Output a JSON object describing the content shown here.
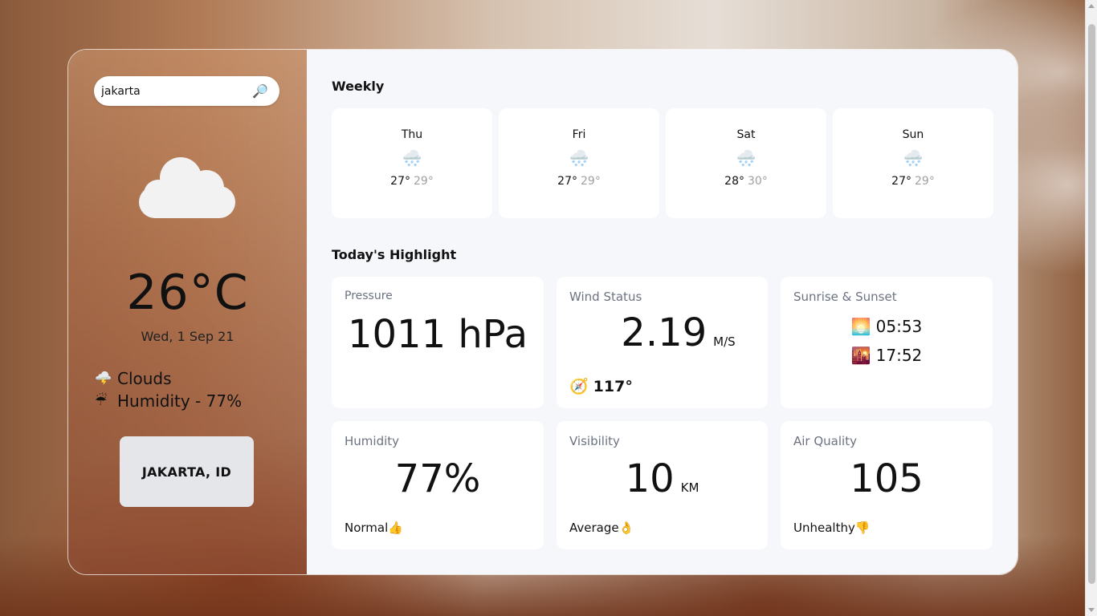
{
  "search": {
    "value": "jakarta",
    "icon": "magnifier-icon"
  },
  "current": {
    "icon": "cloud-icon",
    "temperature": "26°C",
    "date": "Wed, 1 Sep 21",
    "condition": "Clouds",
    "condition_icon": "🌩️",
    "humidity_text": "Humidity - 77%",
    "humidity_icon": "☔",
    "location": "JAKARTA, ID"
  },
  "weekly": {
    "title": "Weekly",
    "days": [
      {
        "name": "Thu",
        "icon": "🌨️",
        "low": "27°",
        "high": "29°"
      },
      {
        "name": "Fri",
        "icon": "🌨️",
        "low": "27°",
        "high": "29°"
      },
      {
        "name": "Sat",
        "icon": "🌨️",
        "low": "28°",
        "high": "30°"
      },
      {
        "name": "Sun",
        "icon": "🌨️",
        "low": "27°",
        "high": "29°"
      }
    ]
  },
  "highlight": {
    "title": "Today's Highlight",
    "pressure": {
      "label": "Pressure",
      "value": "1011 hPa"
    },
    "wind": {
      "label": "Wind Status",
      "value": "2.19",
      "unit": "M/S",
      "direction": "117°",
      "direction_icon": "🧭"
    },
    "sun": {
      "label": "Sunrise & Sunset",
      "sunrise": "05:53",
      "sunrise_icon": "🌅",
      "sunset": "17:52",
      "sunset_icon": "🌇"
    },
    "humidity": {
      "label": "Humidity",
      "value": "77%",
      "status": "Normal👍"
    },
    "visibility": {
      "label": "Visibility",
      "value": "10",
      "unit": "KM",
      "status": "Average👌"
    },
    "air": {
      "label": "Air Quality",
      "value": "105",
      "status": "Unhealthy👎"
    }
  }
}
